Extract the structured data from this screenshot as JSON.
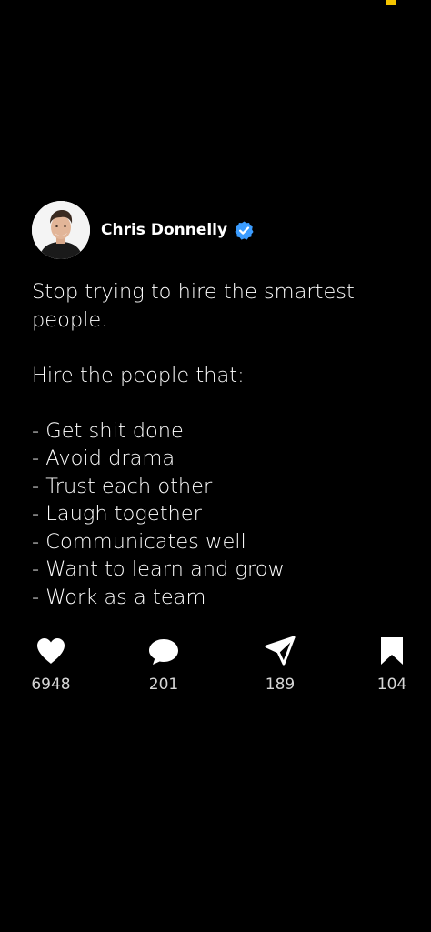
{
  "author": {
    "name": "Chris Donnelly",
    "verified_icon": "verified-badge-icon",
    "verified_color": "#3b9cff"
  },
  "post": {
    "paragraphs": [
      "Stop trying to hire the smartest people.",
      "Hire the people that:"
    ],
    "list": [
      "- Get shit done",
      "- Avoid drama",
      "- Trust each other",
      "- Laugh together",
      "- Communicates well",
      "- Want to learn and grow",
      "- Work as a team"
    ]
  },
  "actions": [
    {
      "icon": "heart-icon",
      "count": "6948"
    },
    {
      "icon": "comment-icon",
      "count": "201"
    },
    {
      "icon": "send-icon",
      "count": "189"
    },
    {
      "icon": "bookmark-icon",
      "count": "104"
    }
  ],
  "colors": {
    "background": "#000000",
    "text": "#ffffff",
    "status_indicator": "#f5c400"
  }
}
